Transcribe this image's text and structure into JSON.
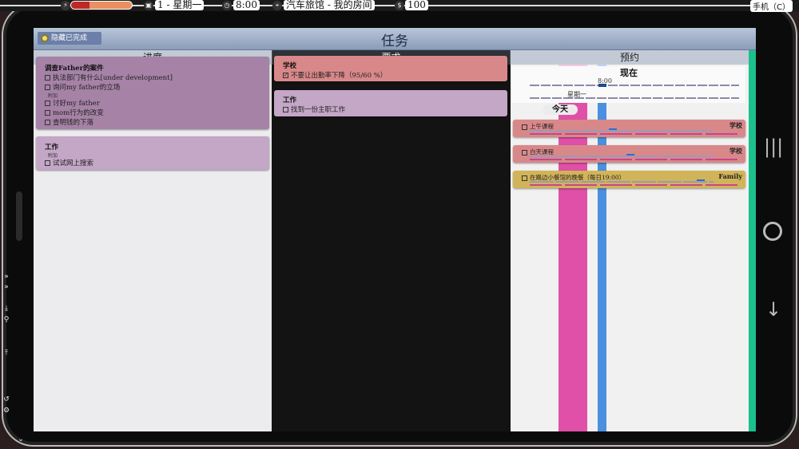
{
  "hud": {
    "date": "1 - 星期一",
    "time": "8:00",
    "location": "汽车旅馆 - 我的房间",
    "money": "100",
    "phone_label": "手机（C）",
    "energy_level": 0.3,
    "icons": [
      "lightning-icon",
      "calendar-icon",
      "clock-icon",
      "location-pin-icon",
      "dollar-icon"
    ]
  },
  "header": {
    "title": "任务",
    "hide_completed_label": "隐藏已完成"
  },
  "columns": {
    "progress": "进度",
    "requirements": "要求",
    "schedule": "预约"
  },
  "progress_cards": [
    {
      "title": "调查Father的案件",
      "tasks": [
        "执法部门有什么[under development]",
        "询问my father的立场"
      ],
      "sub_label": "附加",
      "extra_tasks": [
        "讨好my father",
        "mom行为的改变",
        "查明钱的下落"
      ]
    },
    {
      "title": "工作",
      "sub_label": "附加",
      "extra_tasks": [
        "试试网上搜索"
      ]
    }
  ],
  "requirement_cards": [
    {
      "title": "学校",
      "tasks": [
        {
          "label": "不要让出勤率下降（95/60 %）",
          "checked": true
        }
      ]
    },
    {
      "title": "工作",
      "tasks": [
        {
          "label": "找到一份主职工作",
          "checked": false
        }
      ]
    }
  ],
  "schedule": {
    "now_label": "现在",
    "time": "8:00",
    "day": "星期一",
    "today_label": "今天",
    "items": [
      {
        "name": "上午课程",
        "tag": "学校",
        "color": "#d9888a"
      },
      {
        "name": "白天课程",
        "tag": "学校",
        "color": "#d9888a"
      },
      {
        "name": "在路边小餐馆的晚餐（每日19:00）",
        "tag": "Family",
        "color": "#d2b458"
      }
    ]
  },
  "colors": {
    "progress_card_1": "#a682a6",
    "progress_card_2": "#c4a6c6",
    "req_card_1": "#d9888a",
    "req_card_2": "#c4a6c6",
    "accent_green": "#1bc08c",
    "schedule_pink": "#e050a8",
    "schedule_blue": "#4a90e0"
  }
}
